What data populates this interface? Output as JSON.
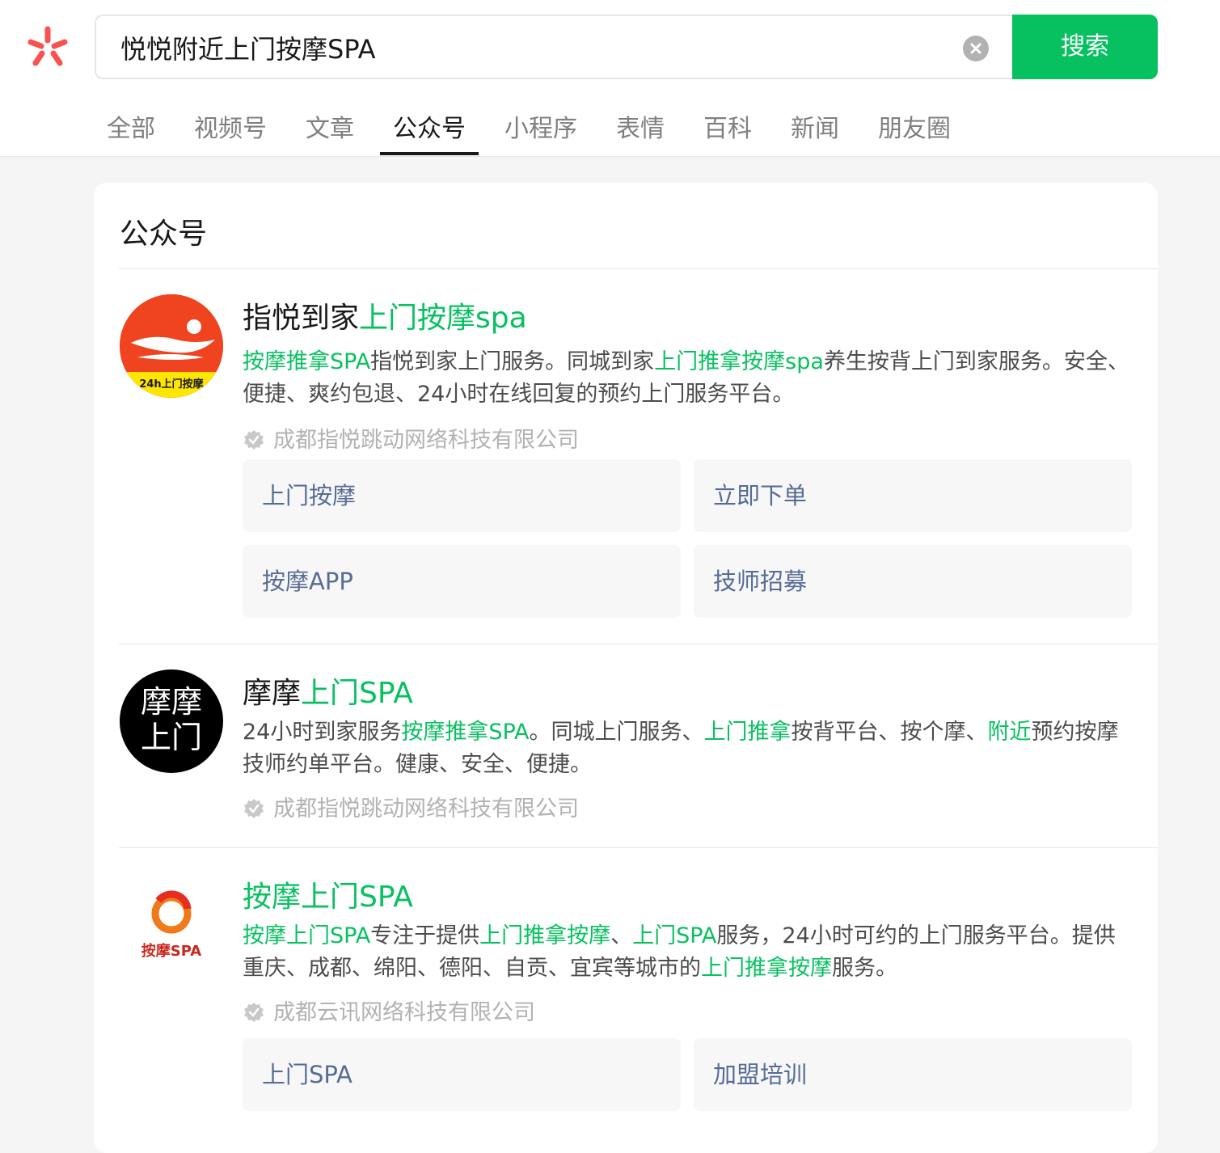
{
  "colors": {
    "accent": "#07c160",
    "link": "#576b95",
    "logo": "#fa5151"
  },
  "search": {
    "query": "悦悦附近上门按摩SPA",
    "button_label": "搜索"
  },
  "tabs": [
    {
      "label": "全部"
    },
    {
      "label": "视频号"
    },
    {
      "label": "文章"
    },
    {
      "label": "公众号",
      "active": true
    },
    {
      "label": "小程序"
    },
    {
      "label": "表情"
    },
    {
      "label": "百科"
    },
    {
      "label": "新闻"
    },
    {
      "label": "朋友圈"
    }
  ],
  "section": {
    "title": "公众号"
  },
  "results": [
    {
      "title_plain": "指悦到家",
      "title_hl": "上门按摩spa",
      "desc": [
        {
          "t": "按摩推拿SPA",
          "hl": true
        },
        {
          "t": "指悦到家上门服务。同城到家",
          "hl": false
        },
        {
          "t": "上门推拿按摩spa",
          "hl": true
        },
        {
          "t": "养生按背上门到家服务。安全、便捷、爽约包退、24小时在线回复的预约上门服务平台。",
          "hl": false
        }
      ],
      "avatar_text": "24h上门按摩",
      "company": "成都指悦跳动网络科技有限公司",
      "menus": [
        "上门按摩",
        "立即下单",
        "按摩APP",
        "技师招募"
      ]
    },
    {
      "title_plain": "摩摩",
      "title_hl": "上门SPA",
      "desc": [
        {
          "t": "24小时到家服务",
          "hl": false
        },
        {
          "t": "按摩推拿SPA",
          "hl": true
        },
        {
          "t": "。同城上门服务、",
          "hl": false
        },
        {
          "t": "上门推拿",
          "hl": true
        },
        {
          "t": "按背平台、按个摩、",
          "hl": false
        },
        {
          "t": "附近",
          "hl": true
        },
        {
          "t": "预约按摩技师约单平台。健康、安全、便捷。",
          "hl": false
        }
      ],
      "avatar_text": "摩摩上门",
      "company": "成都指悦跳动网络科技有限公司",
      "menus": []
    },
    {
      "title_plain": "",
      "title_hl": "按摩上门SPA",
      "desc": [
        {
          "t": "按摩上门SPA",
          "hl": true
        },
        {
          "t": "专注于提供",
          "hl": false
        },
        {
          "t": "上门推拿按摩",
          "hl": true
        },
        {
          "t": "、",
          "hl": false
        },
        {
          "t": "上门SPA",
          "hl": true
        },
        {
          "t": "服务，24小时可约的上门服务平台。提供重庆、成都、绵阳、德阳、自贡、宜宾等城市的",
          "hl": false
        },
        {
          "t": "上门推拿按摩",
          "hl": true
        },
        {
          "t": "服务。",
          "hl": false
        }
      ],
      "avatar_text": "按摩SPA",
      "company": "成都云讯网络科技有限公司",
      "menus": [
        "上门SPA",
        "加盟培训"
      ]
    }
  ]
}
